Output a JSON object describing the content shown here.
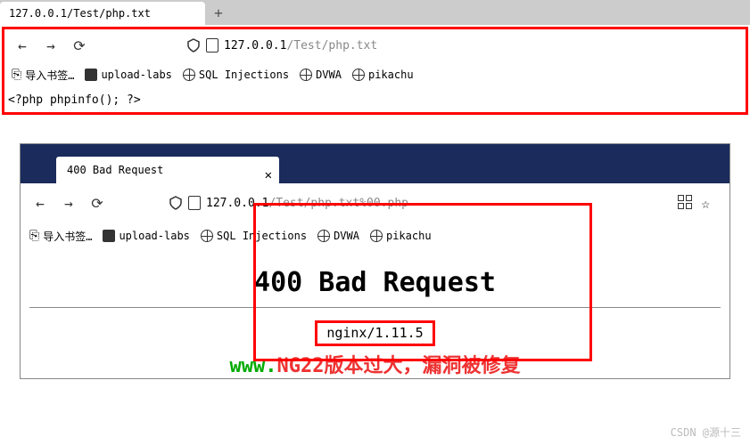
{
  "top": {
    "tab_title": "127.0.0.1/Test/php.txt",
    "url_host": "127.0.0.1",
    "url_path": "/Test/php.txt",
    "bookmarks": {
      "import": "导入书签…",
      "upload_labs": "upload-labs",
      "sql_injections": "SQL Injections",
      "dvwa": "DVWA",
      "pikachu": "pikachu"
    },
    "page_content": "<?php phpinfo(); ?>"
  },
  "bottom": {
    "tab_title": "400 Bad Request",
    "url_host": "127.0.0.1",
    "url_path": "/Test/php.txt%00.php",
    "bookmarks": {
      "import": "导入书签…",
      "upload_labs": "upload-labs",
      "sql_injections": "SQL Injections",
      "dvwa": "DVWA",
      "pikachu": "pikachu"
    },
    "heading": "400 Bad Request",
    "server": "nginx/1.11.5"
  },
  "footer": {
    "www": "www.",
    "mixed": "NG22",
    "message": "版本过大，漏洞被修复"
  },
  "watermark": "CSDN @源十三"
}
